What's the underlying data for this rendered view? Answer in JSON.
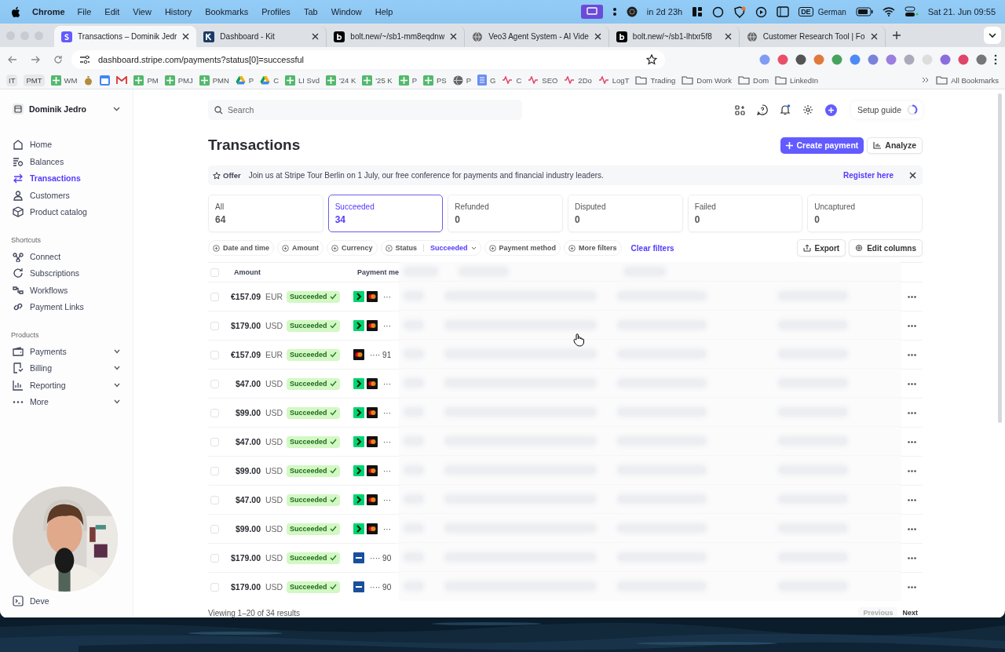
{
  "menubar": {
    "app": "Chrome",
    "menus": [
      "File",
      "Edit",
      "View",
      "History",
      "Bookmarks",
      "Profiles",
      "Tab",
      "Window",
      "Help"
    ],
    "timer": "in 2d 23h",
    "keyboard_code": "DE",
    "keyboard": "German",
    "datetime": "Sat 21. Jun  09:55"
  },
  "browser_tabs": [
    {
      "title": "Transactions – Dominik Jedr",
      "kind": "stripe",
      "selected": true
    },
    {
      "title": "Dashboard - Kit",
      "kind": "kit",
      "selected": false
    },
    {
      "title": "bolt.new/~/sb1-mm8eqdnw",
      "kind": "bolt",
      "selected": false
    },
    {
      "title": "Veo3 Agent System - AI Vide",
      "kind": "globe",
      "selected": false
    },
    {
      "title": "bolt.new/~/sb1-lhtxr5f8",
      "kind": "bolt",
      "selected": false
    },
    {
      "title": "Customer Research Tool | Fo",
      "kind": "globe",
      "selected": false
    }
  ],
  "address": "dashboard.stripe.com/payments?status[0]=successful",
  "bookmarks": [
    {
      "label": "IT",
      "kind": "chip"
    },
    {
      "label": "PMT",
      "kind": "chip"
    },
    {
      "label": "WM",
      "kind": "sheet"
    },
    {
      "label": "PM",
      "kind": "sheet"
    },
    {
      "label": "PMJ",
      "kind": "sheet"
    },
    {
      "label": "PMN",
      "kind": "sheet"
    },
    {
      "label": "P",
      "kind": "drive"
    },
    {
      "label": "C",
      "kind": "drive"
    },
    {
      "label": "LI Svd",
      "kind": "sheet"
    },
    {
      "label": "'24 K",
      "kind": "sheet"
    },
    {
      "label": "'25 K",
      "kind": "sheet"
    },
    {
      "label": "P",
      "kind": "sheet"
    },
    {
      "label": "PS",
      "kind": "sheet"
    },
    {
      "label": "P",
      "kind": "globe"
    },
    {
      "label": "G",
      "kind": "doc"
    },
    {
      "label": "C",
      "kind": "pulse"
    },
    {
      "label": "SEO",
      "kind": "pulse"
    },
    {
      "label": "2Do",
      "kind": "pulse"
    },
    {
      "label": "LogT",
      "kind": "pulse"
    },
    {
      "label": "Trading",
      "kind": "folder"
    },
    {
      "label": "Dom Work",
      "kind": "folder"
    },
    {
      "label": "Dom",
      "kind": "folder"
    },
    {
      "label": "LinkedIn",
      "kind": "folder"
    }
  ],
  "all_bookmarks": "All Bookmarks",
  "sidebar": {
    "account": "Dominik Jedro",
    "nav": [
      {
        "label": "Home",
        "kind": "home",
        "selected": false
      },
      {
        "label": "Balances",
        "kind": "balances",
        "selected": false
      },
      {
        "label": "Transactions",
        "kind": "transfer",
        "selected": true
      },
      {
        "label": "Customers",
        "kind": "person",
        "selected": false
      },
      {
        "label": "Product catalog",
        "kind": "box",
        "selected": false
      }
    ],
    "shortcuts_title": "Shortcuts",
    "shortcuts": [
      {
        "label": "Connect",
        "kind": "connect"
      },
      {
        "label": "Subscriptions",
        "kind": "subs"
      },
      {
        "label": "Workflows",
        "kind": "flow"
      },
      {
        "label": "Payment Links",
        "kind": "link"
      }
    ],
    "products_title": "Products",
    "products": [
      {
        "label": "Payments",
        "kind": "wallet",
        "expanded": false
      },
      {
        "label": "Billing",
        "kind": "bill",
        "expanded": false
      },
      {
        "label": "Reporting",
        "kind": "chart",
        "expanded": false
      },
      {
        "label": "More",
        "kind": "dots",
        "expanded": false
      }
    ],
    "developers": "Deve"
  },
  "search": {
    "placeholder": "Search"
  },
  "setup_guide": "Setup guide",
  "title": "Transactions",
  "create_button": "Create payment",
  "analyze_button": "Analyze",
  "banner": {
    "tag": "Offer",
    "text": "Join us at Stripe Tour Berlin on 1 July, our free conference for payments and financial industry leaders.",
    "link": "Register here"
  },
  "status_tabs": [
    {
      "label": "All",
      "count": "64",
      "selected": false
    },
    {
      "label": "Succeeded",
      "count": "34",
      "selected": true
    },
    {
      "label": "Refunded",
      "count": "0",
      "selected": false
    },
    {
      "label": "Disputed",
      "count": "0",
      "selected": false
    },
    {
      "label": "Failed",
      "count": "0",
      "selected": false
    },
    {
      "label": "Uncaptured",
      "count": "0",
      "selected": false
    }
  ],
  "filters": [
    {
      "label": "Date and time",
      "kind": "add"
    },
    {
      "label": "Amount",
      "kind": "add"
    },
    {
      "label": "Currency",
      "kind": "add"
    },
    {
      "label": "Status",
      "kind": "applied",
      "value": "Succeeded"
    },
    {
      "label": "Payment method",
      "kind": "add"
    },
    {
      "label": "More filters",
      "kind": "add"
    }
  ],
  "clear_filters": "Clear filters",
  "export_button": "Export",
  "edit_columns_button": "Edit columns",
  "table": {
    "columns": [
      "Amount",
      "Payment me"
    ],
    "select_all_checked": false,
    "rows": [
      {
        "checked": false,
        "amount": "€157.09",
        "currency": "EUR",
        "status": "Succeeded",
        "kind": "link",
        "card": "···"
      },
      {
        "checked": false,
        "amount": "$179.00",
        "currency": "USD",
        "status": "Succeeded",
        "kind": "link",
        "card": "···"
      },
      {
        "checked": false,
        "amount": "€157.09",
        "currency": "EUR",
        "status": "Succeeded",
        "kind": "mastercard",
        "card": "···· 91"
      },
      {
        "checked": false,
        "amount": "$47.00",
        "currency": "USD",
        "status": "Succeeded",
        "kind": "link",
        "card": "···"
      },
      {
        "checked": false,
        "amount": "$99.00",
        "currency": "USD",
        "status": "Succeeded",
        "kind": "link",
        "card": "···"
      },
      {
        "checked": false,
        "amount": "$47.00",
        "currency": "USD",
        "status": "Succeeded",
        "kind": "link",
        "card": "···"
      },
      {
        "checked": false,
        "amount": "$99.00",
        "currency": "USD",
        "status": "Succeeded",
        "kind": "link",
        "card": "···"
      },
      {
        "checked": false,
        "amount": "$47.00",
        "currency": "USD",
        "status": "Succeeded",
        "kind": "link",
        "card": "···"
      },
      {
        "checked": false,
        "amount": "$99.00",
        "currency": "USD",
        "status": "Succeeded",
        "kind": "link",
        "card": "···"
      },
      {
        "checked": false,
        "amount": "$179.00",
        "currency": "USD",
        "status": "Succeeded",
        "kind": "visa",
        "card": "···· 90"
      },
      {
        "checked": false,
        "amount": "$179.00",
        "currency": "USD",
        "status": "Succeeded",
        "kind": "visa",
        "card": "···· 90"
      }
    ]
  },
  "pagination": {
    "summary": "Viewing 1–20 of 34 results",
    "previous": "Previous",
    "previous_disabled": true,
    "next": "Next"
  }
}
